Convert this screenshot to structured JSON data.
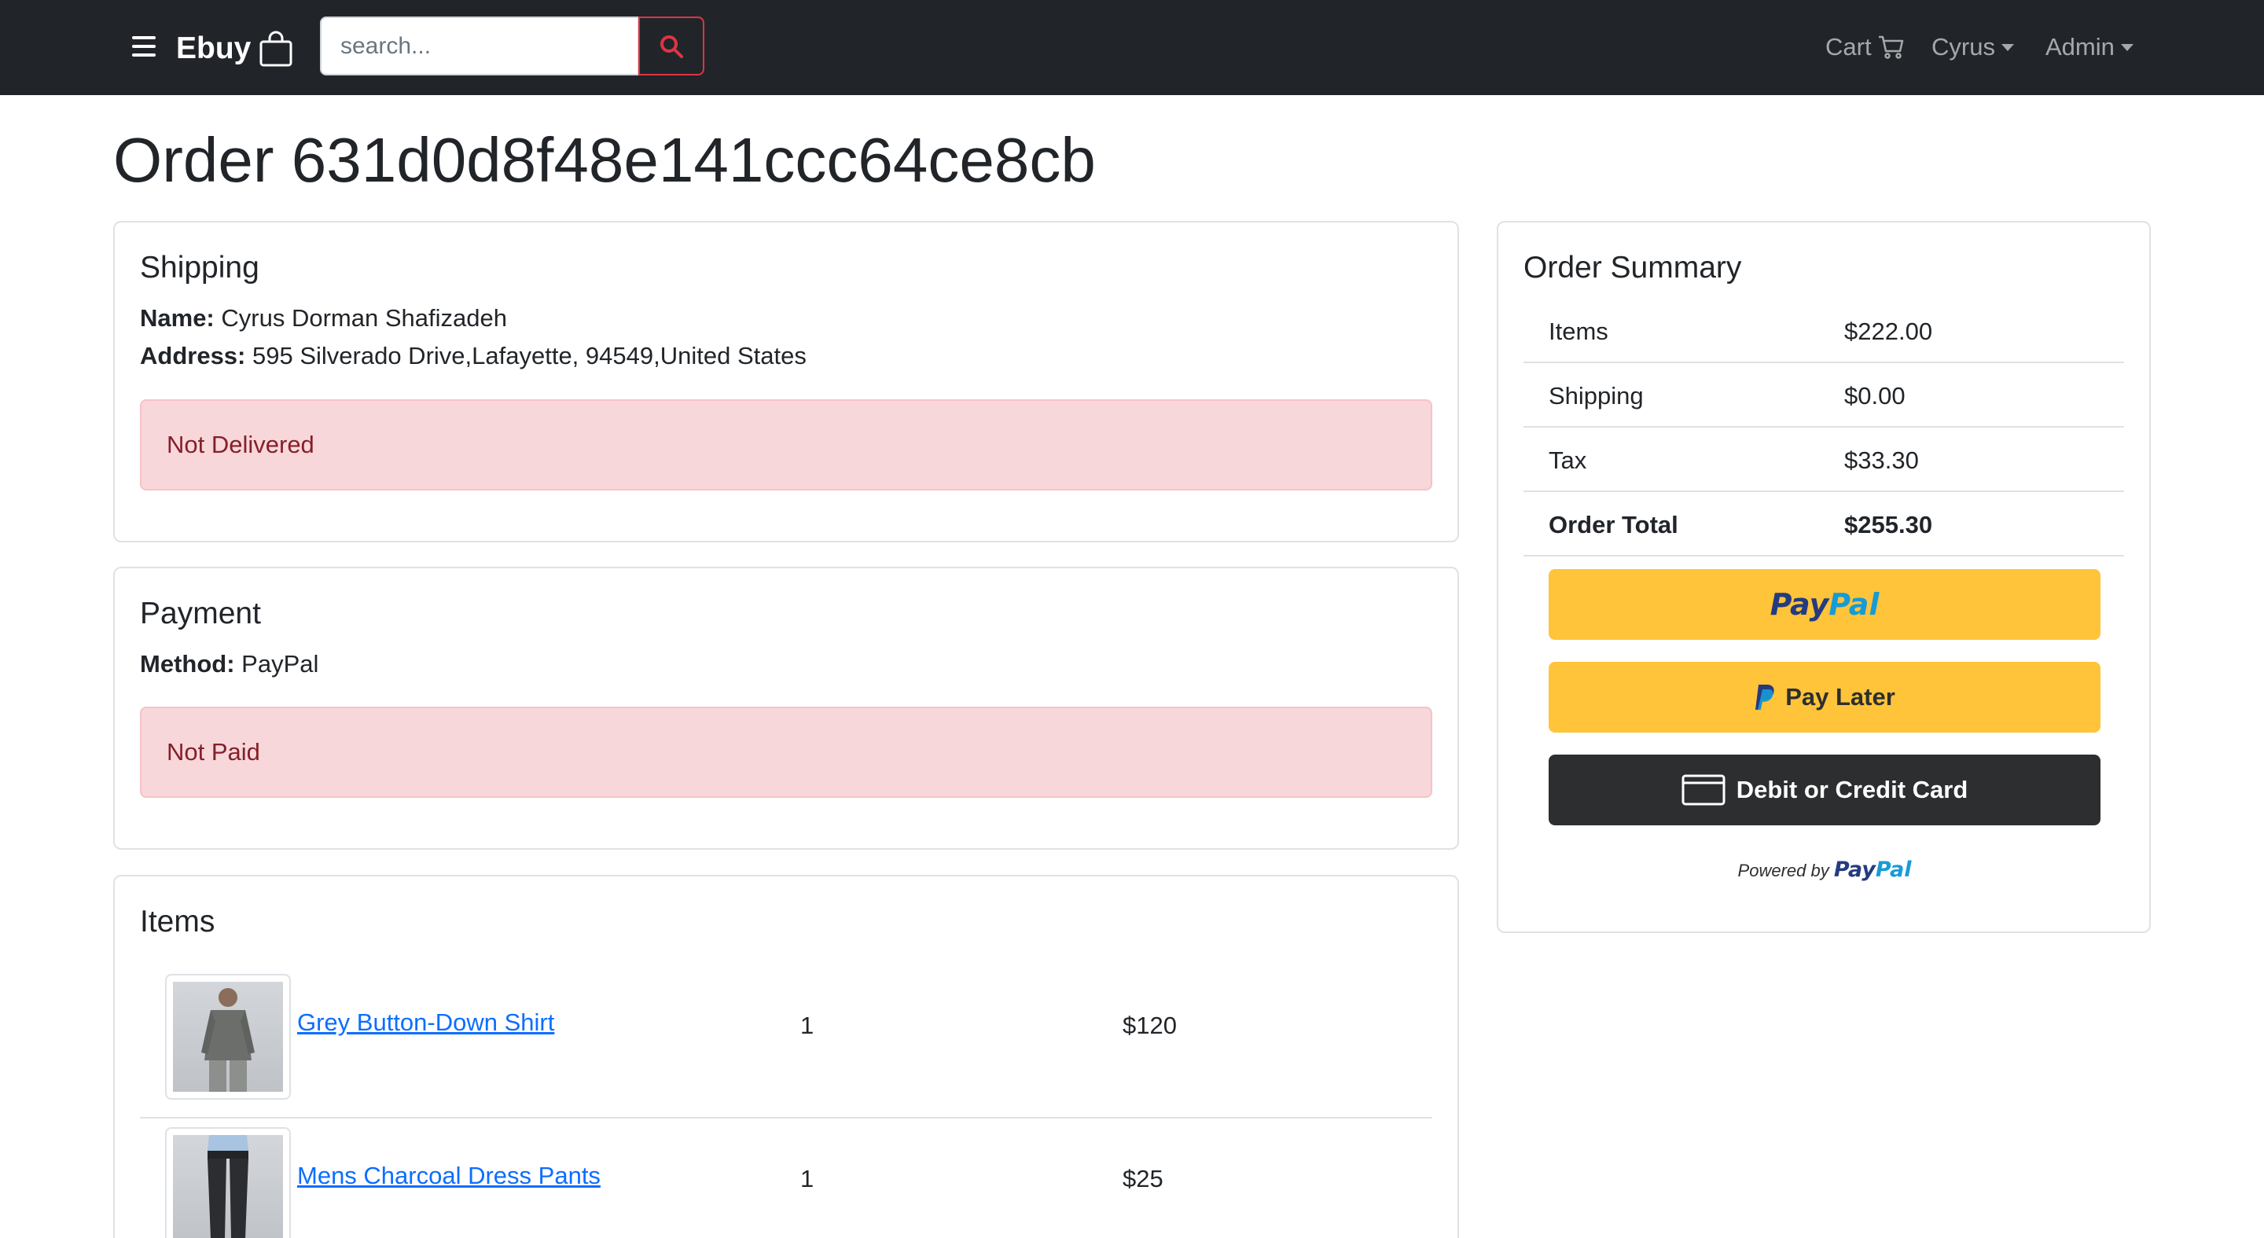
{
  "nav": {
    "brand": "Ebuy",
    "search_placeholder": "search...",
    "cart": "Cart",
    "user": "Cyrus",
    "admin": "Admin"
  },
  "order": {
    "title": "Order 631d0d8f48e141ccc64ce8cb"
  },
  "shipping": {
    "heading": "Shipping",
    "name_label": "Name:",
    "name": "Cyrus Dorman Shafizadeh",
    "address_label": "Address:",
    "address": "595 Silverado Drive,Lafayette, 94549,United States",
    "status": "Not Delivered"
  },
  "payment": {
    "heading": "Payment",
    "method_label": "Method:",
    "method": "PayPal",
    "status": "Not Paid"
  },
  "items": {
    "heading": "Items",
    "list": [
      {
        "name": "Grey Button-Down Shirt",
        "qty": "1",
        "price": "$120"
      },
      {
        "name": "Mens Charcoal Dress Pants",
        "qty": "1",
        "price": "$25"
      }
    ]
  },
  "summary": {
    "heading": "Order Summary",
    "rows": [
      {
        "label": "Items",
        "value": "$222.00"
      },
      {
        "label": "Shipping",
        "value": "$0.00"
      },
      {
        "label": "Tax",
        "value": "$33.30"
      },
      {
        "label": "Order Total",
        "value": "$255.30"
      }
    ]
  },
  "paypal": {
    "logo_pay": "Pay",
    "logo_pal": "Pal",
    "pay_later": "Pay Later",
    "card": "Debit or Credit Card",
    "powered_by": "Powered by"
  },
  "colors": {
    "navbar": "#212529",
    "alert_bg": "#f8d7da",
    "alert_text": "#842029",
    "paypal_yellow": "#ffc439",
    "link": "#0d6efd"
  }
}
